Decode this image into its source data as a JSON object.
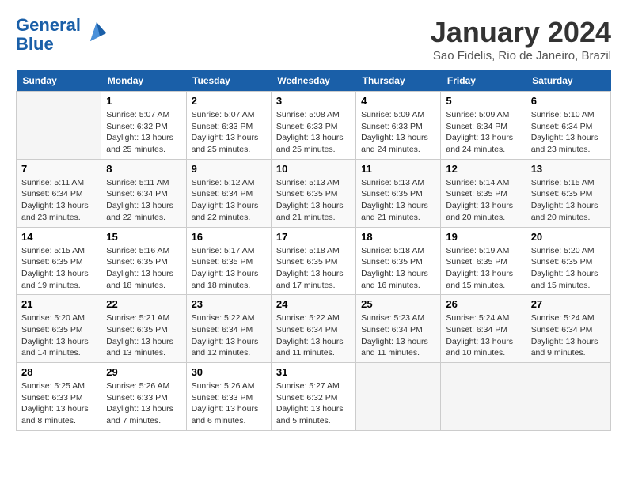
{
  "header": {
    "logo_line1": "General",
    "logo_line2": "Blue",
    "title": "January 2024",
    "location": "Sao Fidelis, Rio de Janeiro, Brazil"
  },
  "days_of_week": [
    "Sunday",
    "Monday",
    "Tuesday",
    "Wednesday",
    "Thursday",
    "Friday",
    "Saturday"
  ],
  "weeks": [
    [
      {
        "day": "",
        "info": ""
      },
      {
        "day": "1",
        "info": "Sunrise: 5:07 AM\nSunset: 6:32 PM\nDaylight: 13 hours\nand 25 minutes."
      },
      {
        "day": "2",
        "info": "Sunrise: 5:07 AM\nSunset: 6:33 PM\nDaylight: 13 hours\nand 25 minutes."
      },
      {
        "day": "3",
        "info": "Sunrise: 5:08 AM\nSunset: 6:33 PM\nDaylight: 13 hours\nand 25 minutes."
      },
      {
        "day": "4",
        "info": "Sunrise: 5:09 AM\nSunset: 6:33 PM\nDaylight: 13 hours\nand 24 minutes."
      },
      {
        "day": "5",
        "info": "Sunrise: 5:09 AM\nSunset: 6:34 PM\nDaylight: 13 hours\nand 24 minutes."
      },
      {
        "day": "6",
        "info": "Sunrise: 5:10 AM\nSunset: 6:34 PM\nDaylight: 13 hours\nand 23 minutes."
      }
    ],
    [
      {
        "day": "7",
        "info": "Sunrise: 5:11 AM\nSunset: 6:34 PM\nDaylight: 13 hours\nand 23 minutes."
      },
      {
        "day": "8",
        "info": "Sunrise: 5:11 AM\nSunset: 6:34 PM\nDaylight: 13 hours\nand 22 minutes."
      },
      {
        "day": "9",
        "info": "Sunrise: 5:12 AM\nSunset: 6:34 PM\nDaylight: 13 hours\nand 22 minutes."
      },
      {
        "day": "10",
        "info": "Sunrise: 5:13 AM\nSunset: 6:35 PM\nDaylight: 13 hours\nand 21 minutes."
      },
      {
        "day": "11",
        "info": "Sunrise: 5:13 AM\nSunset: 6:35 PM\nDaylight: 13 hours\nand 21 minutes."
      },
      {
        "day": "12",
        "info": "Sunrise: 5:14 AM\nSunset: 6:35 PM\nDaylight: 13 hours\nand 20 minutes."
      },
      {
        "day": "13",
        "info": "Sunrise: 5:15 AM\nSunset: 6:35 PM\nDaylight: 13 hours\nand 20 minutes."
      }
    ],
    [
      {
        "day": "14",
        "info": "Sunrise: 5:15 AM\nSunset: 6:35 PM\nDaylight: 13 hours\nand 19 minutes."
      },
      {
        "day": "15",
        "info": "Sunrise: 5:16 AM\nSunset: 6:35 PM\nDaylight: 13 hours\nand 18 minutes."
      },
      {
        "day": "16",
        "info": "Sunrise: 5:17 AM\nSunset: 6:35 PM\nDaylight: 13 hours\nand 18 minutes."
      },
      {
        "day": "17",
        "info": "Sunrise: 5:18 AM\nSunset: 6:35 PM\nDaylight: 13 hours\nand 17 minutes."
      },
      {
        "day": "18",
        "info": "Sunrise: 5:18 AM\nSunset: 6:35 PM\nDaylight: 13 hours\nand 16 minutes."
      },
      {
        "day": "19",
        "info": "Sunrise: 5:19 AM\nSunset: 6:35 PM\nDaylight: 13 hours\nand 15 minutes."
      },
      {
        "day": "20",
        "info": "Sunrise: 5:20 AM\nSunset: 6:35 PM\nDaylight: 13 hours\nand 15 minutes."
      }
    ],
    [
      {
        "day": "21",
        "info": "Sunrise: 5:20 AM\nSunset: 6:35 PM\nDaylight: 13 hours\nand 14 minutes."
      },
      {
        "day": "22",
        "info": "Sunrise: 5:21 AM\nSunset: 6:35 PM\nDaylight: 13 hours\nand 13 minutes."
      },
      {
        "day": "23",
        "info": "Sunrise: 5:22 AM\nSunset: 6:34 PM\nDaylight: 13 hours\nand 12 minutes."
      },
      {
        "day": "24",
        "info": "Sunrise: 5:22 AM\nSunset: 6:34 PM\nDaylight: 13 hours\nand 11 minutes."
      },
      {
        "day": "25",
        "info": "Sunrise: 5:23 AM\nSunset: 6:34 PM\nDaylight: 13 hours\nand 11 minutes."
      },
      {
        "day": "26",
        "info": "Sunrise: 5:24 AM\nSunset: 6:34 PM\nDaylight: 13 hours\nand 10 minutes."
      },
      {
        "day": "27",
        "info": "Sunrise: 5:24 AM\nSunset: 6:34 PM\nDaylight: 13 hours\nand 9 minutes."
      }
    ],
    [
      {
        "day": "28",
        "info": "Sunrise: 5:25 AM\nSunset: 6:33 PM\nDaylight: 13 hours\nand 8 minutes."
      },
      {
        "day": "29",
        "info": "Sunrise: 5:26 AM\nSunset: 6:33 PM\nDaylight: 13 hours\nand 7 minutes."
      },
      {
        "day": "30",
        "info": "Sunrise: 5:26 AM\nSunset: 6:33 PM\nDaylight: 13 hours\nand 6 minutes."
      },
      {
        "day": "31",
        "info": "Sunrise: 5:27 AM\nSunset: 6:32 PM\nDaylight: 13 hours\nand 5 minutes."
      },
      {
        "day": "",
        "info": ""
      },
      {
        "day": "",
        "info": ""
      },
      {
        "day": "",
        "info": ""
      }
    ]
  ]
}
